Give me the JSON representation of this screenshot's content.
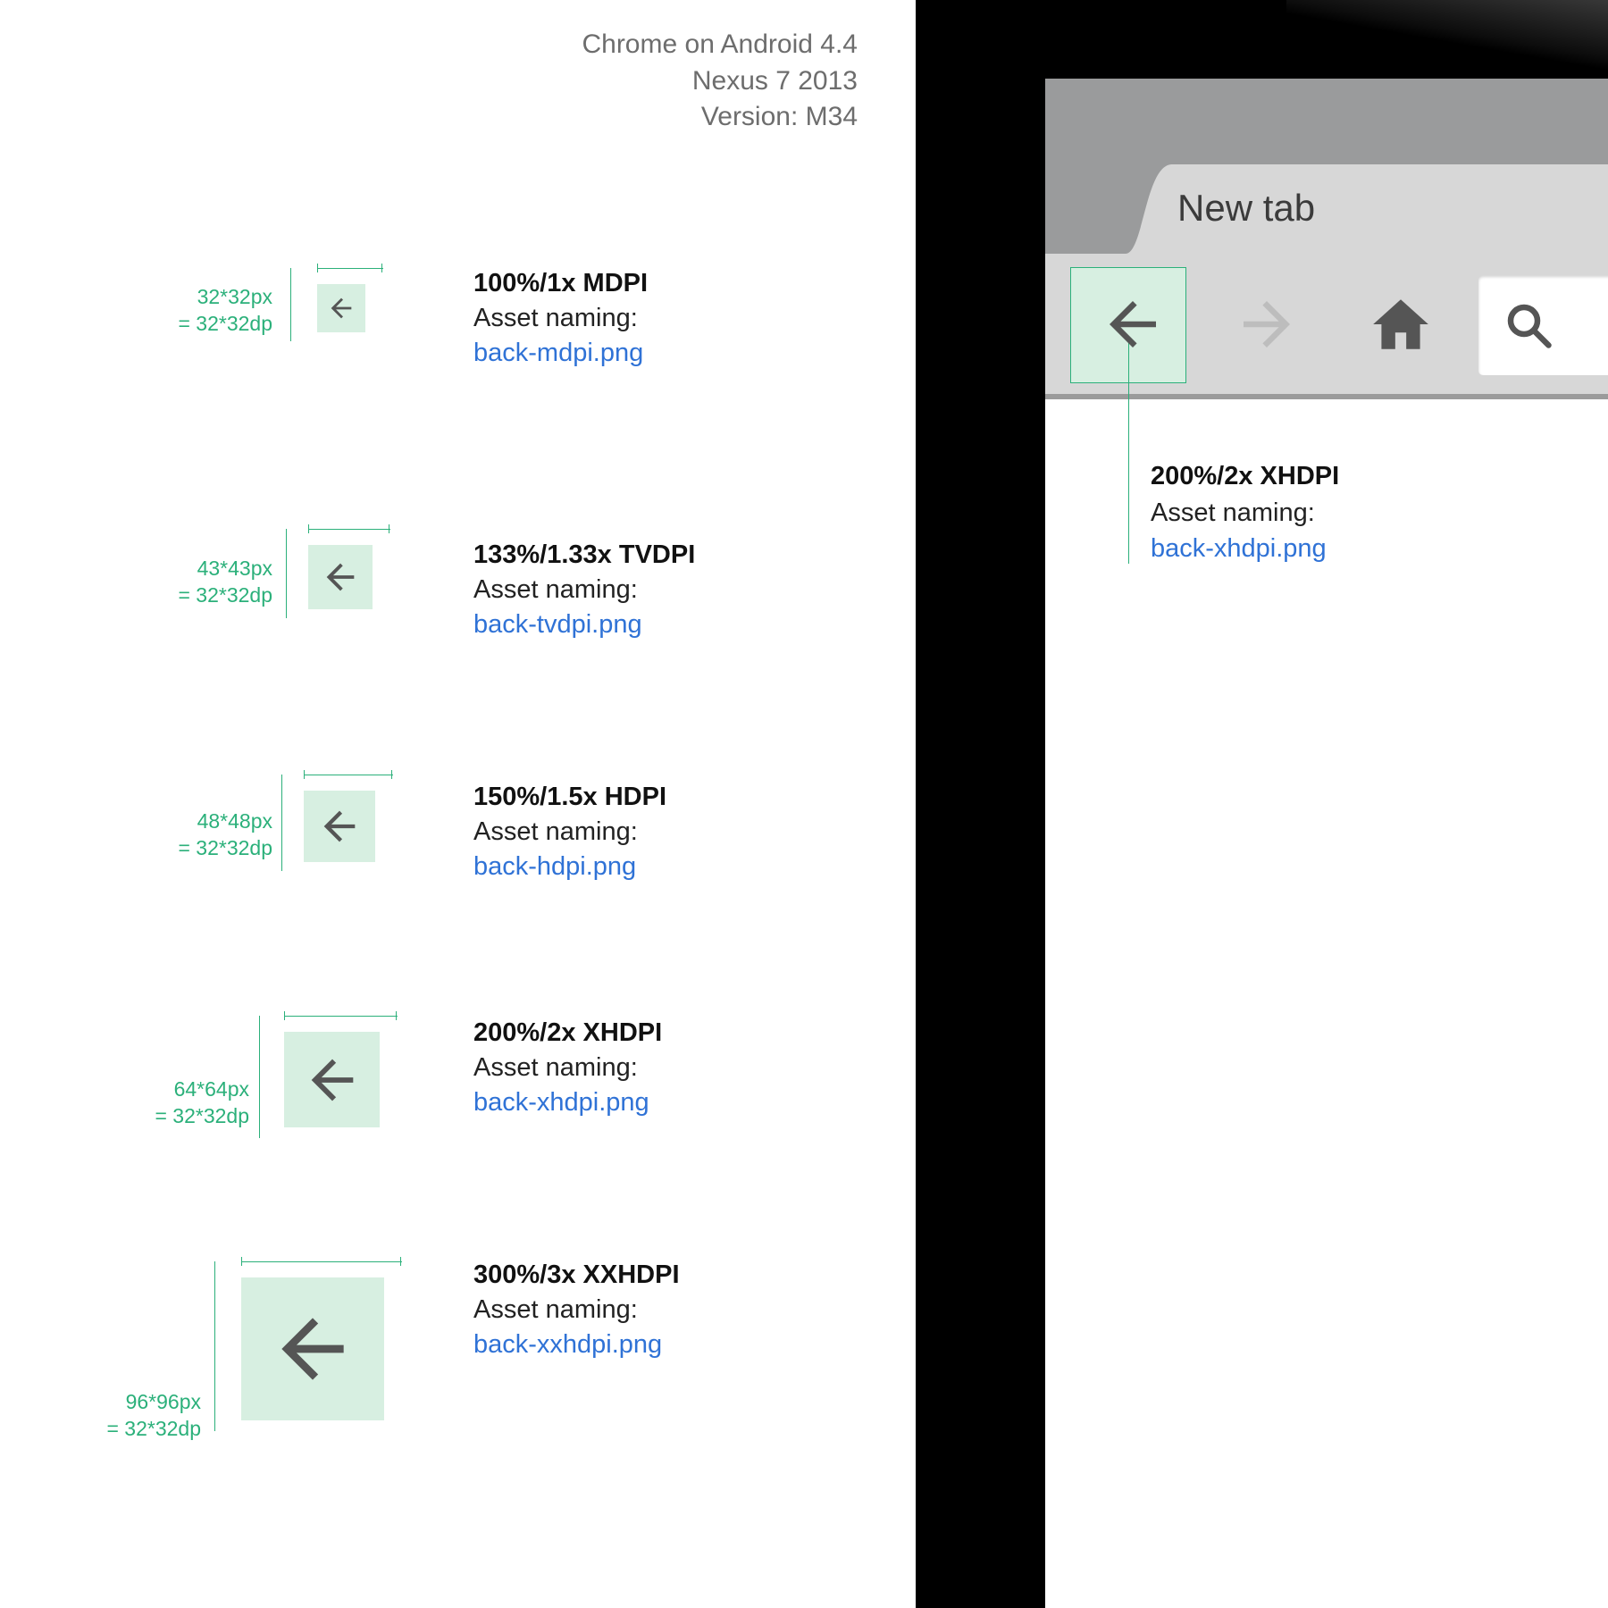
{
  "header": {
    "line1": "Chrome on Android 4.4",
    "line2": "Nexus 7 2013",
    "line3": "Version: M34"
  },
  "rows": [
    {
      "px": "32*32px",
      "dp": "= 32*32dp",
      "title": "100%/1x MDPI",
      "sub": "Asset naming:",
      "file": "back-mdpi.png",
      "size": 54
    },
    {
      "px": "43*43px",
      "dp": "= 32*32dp",
      "title": "133%/1.33x TVDPI",
      "sub": "Asset naming:",
      "file": "back-tvdpi.png",
      "size": 72
    },
    {
      "px": "48*48px",
      "dp": "= 32*32dp",
      "title": "150%/1.5x HDPI",
      "sub": "Asset naming:",
      "file": "back-hdpi.png",
      "size": 80
    },
    {
      "px": "64*64px",
      "dp": "= 32*32dp",
      "title": "200%/2x XHDPI",
      "sub": "Asset naming:",
      "file": "back-xhdpi.png",
      "size": 107
    },
    {
      "px": "96*96px",
      "dp": "= 32*32dp",
      "title": "300%/3x XXHDPI",
      "sub": "Asset naming:",
      "file": "back-xxhdpi.png",
      "size": 160
    }
  ],
  "device": {
    "tab_label": "New tab",
    "callout": {
      "title": "200%/2x XHDPI",
      "sub": "Asset naming:",
      "file": "back-xhdpi.png"
    }
  }
}
